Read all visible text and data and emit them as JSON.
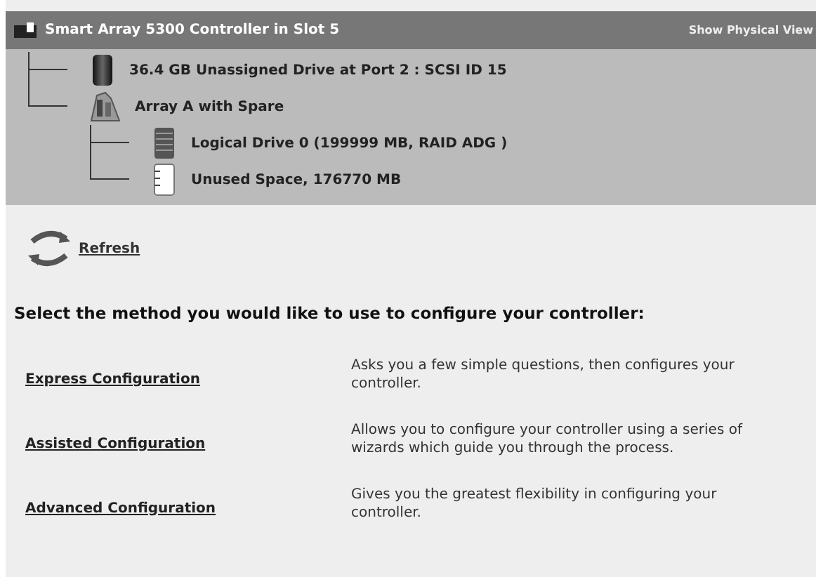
{
  "header": {
    "title": "Smart Array 5300 Controller in Slot 5",
    "link": "Show Physical View"
  },
  "tree": [
    {
      "kind": "drive",
      "label": "36.4 GB Unassigned Drive at Port 2 : SCSI ID 15"
    },
    {
      "kind": "array",
      "label": "Array A with Spare",
      "children": [
        {
          "kind": "logical",
          "label": "Logical Drive 0 (199999 MB, RAID ADG )"
        },
        {
          "kind": "unused",
          "label": "Unused Space, 176770 MB"
        }
      ]
    }
  ],
  "refresh": "Refresh",
  "prompt": "Select the method you would like to use to configure your controller:",
  "methods": [
    {
      "label": "Express Configuration",
      "description": "Asks you a few simple questions, then configures your controller."
    },
    {
      "label": "Assisted Configuration",
      "description": "Allows you to configure your controller using a series of wizards which guide you through the process."
    },
    {
      "label": "Advanced Configuration",
      "description": "Gives you the greatest flexibility in configuring your controller."
    }
  ]
}
